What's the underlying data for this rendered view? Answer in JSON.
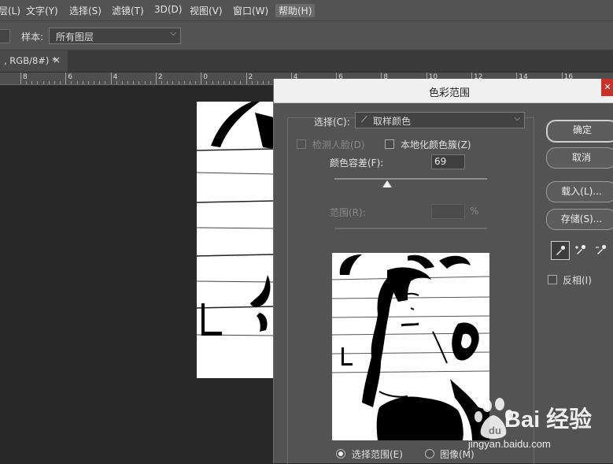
{
  "menubar": {
    "items": [
      {
        "label": "层(L)"
      },
      {
        "label": "文字(Y)"
      },
      {
        "label": "选择(S)"
      },
      {
        "label": "滤镜(T)"
      },
      {
        "label": "3D(D)"
      },
      {
        "label": "视图(V)"
      },
      {
        "label": "窗口(W)"
      },
      {
        "label": "帮助(H)"
      }
    ]
  },
  "options_bar": {
    "sample_label": "样本:",
    "sample_value": "所有图层"
  },
  "document_tab": {
    "title": ", RGB/8#) *",
    "close": "×"
  },
  "ruler": {
    "labels": [
      "8",
      "6",
      "4",
      "2",
      "0",
      "2",
      "4",
      "6",
      "8",
      "10",
      "12",
      "14",
      "16"
    ]
  },
  "dialog": {
    "title": "色彩范围",
    "close_glyph": "✕",
    "select_label": "选择(C):",
    "select_value": "取样颜色",
    "detect_faces_label": "检测人脸(D)",
    "localized_clusters_label": "本地化颜色簇(Z)",
    "fuzziness_label": "颜色容差(F):",
    "fuzziness_value": "69",
    "range_label": "范围(R):",
    "range_unit": "%",
    "radio_selection": "选择范围(E)",
    "radio_image": "图像(M)",
    "buttons": {
      "ok": "确定",
      "cancel": "取消",
      "load": "载入(L)...",
      "save": "存储(S)..."
    },
    "invert_label": "反相(I)"
  },
  "watermark": {
    "brand": "Bai 经验",
    "url": "jingyan.baidu.com"
  }
}
